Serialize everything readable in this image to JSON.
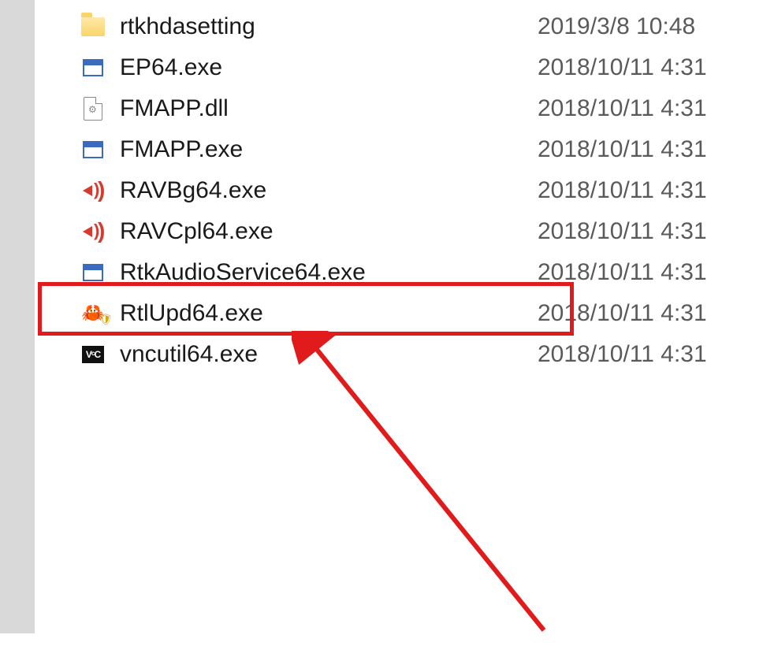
{
  "files": [
    {
      "name": "rtkhdasetting",
      "date": "2019/3/8 10:48",
      "icon": "folder"
    },
    {
      "name": "EP64.exe",
      "date": "2018/10/11 4:31",
      "icon": "appwin"
    },
    {
      "name": "FMAPP.dll",
      "date": "2018/10/11 4:31",
      "icon": "dll"
    },
    {
      "name": "FMAPP.exe",
      "date": "2018/10/11 4:31",
      "icon": "appwin"
    },
    {
      "name": "RAVBg64.exe",
      "date": "2018/10/11 4:31",
      "icon": "speaker"
    },
    {
      "name": "RAVCpl64.exe",
      "date": "2018/10/11 4:31",
      "icon": "speaker"
    },
    {
      "name": "RtkAudioService64.exe",
      "date": "2018/10/11 4:31",
      "icon": "appwin"
    },
    {
      "name": "RtlUpd64.exe",
      "date": "2018/10/11 4:31",
      "icon": "crab"
    },
    {
      "name": "vncutil64.exe",
      "date": "2018/10/11 4:31",
      "icon": "vnc"
    }
  ],
  "annotation": {
    "highlighted_file": "RtlUpd64.exe",
    "box_color": "#e11b1b"
  }
}
